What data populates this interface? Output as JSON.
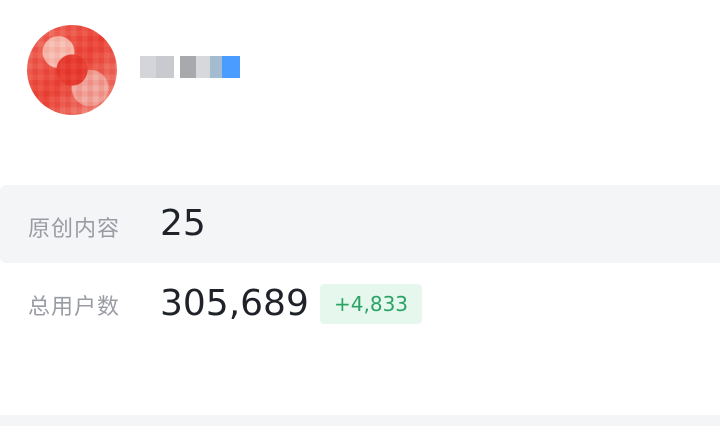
{
  "stats": {
    "content": {
      "label": "原创内容",
      "value": "25"
    },
    "users": {
      "label": "总用户数",
      "value": "305,689",
      "delta": "+4,833"
    }
  },
  "colors": {
    "accent_green": "#2aa465",
    "badge_bg": "#e6f7ee",
    "row_bg": "#f4f5f7",
    "label_gray": "#999ca3",
    "value_dark": "#1f2329"
  }
}
